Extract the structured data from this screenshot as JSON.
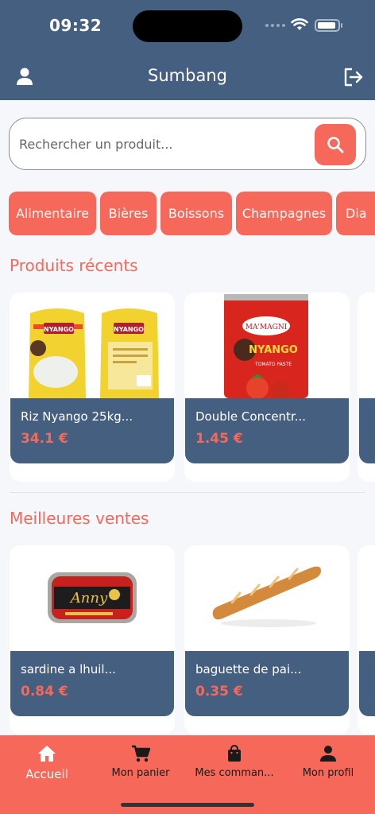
{
  "status_bar": {
    "time": "09:32"
  },
  "app_bar": {
    "title": "Sumbang",
    "profile_icon": "person-icon",
    "logout_icon": "logout-icon"
  },
  "search": {
    "placeholder": "Rechercher un produit...",
    "value": "",
    "button_icon": "search-icon"
  },
  "categories": [
    {
      "label": "Alimentaire"
    },
    {
      "label": "Bières"
    },
    {
      "label": "Boissons"
    },
    {
      "label": "Champagnes"
    },
    {
      "label": "Dia"
    }
  ],
  "recent": {
    "title": "Produits récents",
    "products": [
      {
        "name": "Riz Nyango 25kg...",
        "price": "34.1 €",
        "image": "rice-bags-image"
      },
      {
        "name": "Double Concentr...",
        "price": "1.45 €",
        "image": "tomato-paste-can-image"
      }
    ]
  },
  "best": {
    "title": "Meilleures ventes",
    "products": [
      {
        "name": "sardine a lhuil...",
        "price": "0.84 €",
        "image": "sardine-tin-image"
      },
      {
        "name": "baguette de pai...",
        "price": "0.35 €",
        "image": "baguette-image"
      }
    ]
  },
  "bottom_nav": [
    {
      "label": "Accueil",
      "icon": "home-icon",
      "active": true
    },
    {
      "label": "Mon panier",
      "icon": "cart-icon",
      "active": false
    },
    {
      "label": "Mes comman...",
      "icon": "shopping-bag-icon",
      "active": false
    },
    {
      "label": "Mon profil",
      "icon": "person-icon",
      "active": false
    }
  ],
  "colors": {
    "primary": "#455f80",
    "accent": "#f6695a",
    "background": "#f6f7fb"
  }
}
